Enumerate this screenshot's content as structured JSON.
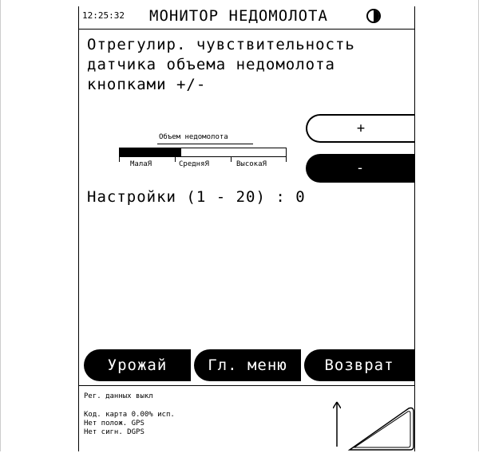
{
  "header": {
    "time": "12:25:32",
    "title": "МОНИТОР НЕДОМОЛОТА",
    "contrast_icon": "contrast-icon"
  },
  "instruction": "Отрегулир. чувствительность\nдатчика объема недомолота\nкнопками +/-",
  "gauge": {
    "label": "Объем недомолота",
    "level_fraction": 0.37,
    "scale": [
      "МалаЯ",
      "СредняЯ",
      "ВысокаЯ"
    ]
  },
  "buttons": {
    "plus": "+",
    "minus": "-"
  },
  "settings": {
    "text": "Настройки (1 - 20) : 0",
    "value": 0
  },
  "softkeys": [
    "Урожай",
    "Гл. меню",
    "Возврат"
  ],
  "status": {
    "logging": "Рег. данных выкл",
    "card": "Код. карта   0.00% исп.",
    "position": "Нет полож. GPS",
    "dgps": "Нет сигн. DGPS"
  }
}
